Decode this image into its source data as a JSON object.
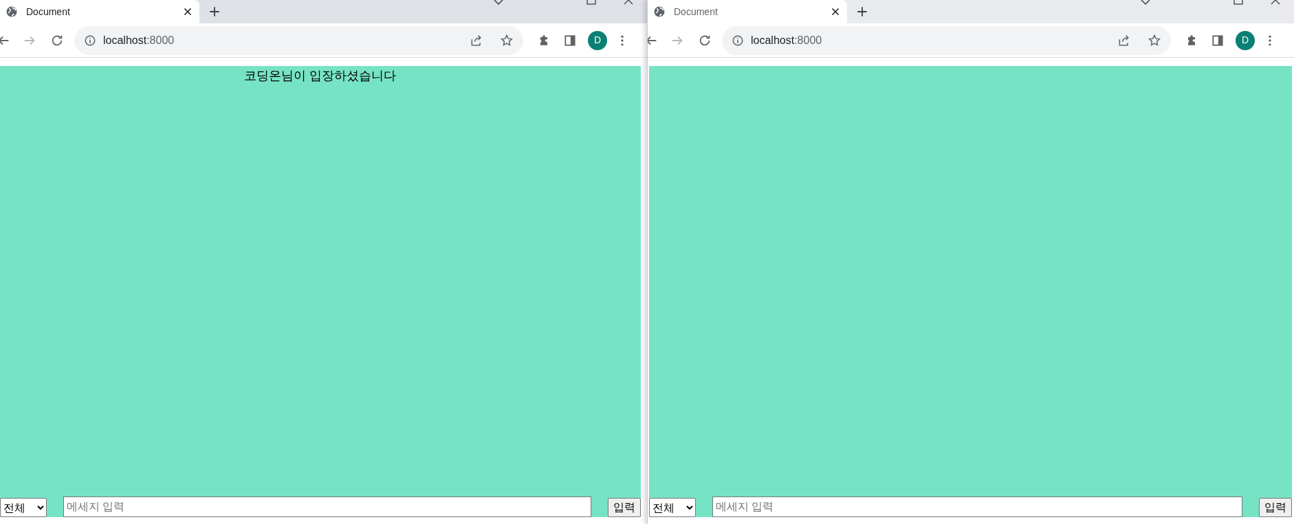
{
  "windows": [
    {
      "focused": true,
      "tab": {
        "title": "Document"
      },
      "address": {
        "host": "localhost",
        "port": ":8000"
      },
      "profile": {
        "letter": "D"
      },
      "messages": [
        "코딩온님이 입장하셨습니다"
      ],
      "chat_form": {
        "recipient": "전체",
        "placeholder": "메세지 입력",
        "submit": "입력"
      }
    },
    {
      "focused": false,
      "tab": {
        "title": "Document"
      },
      "address": {
        "host": "localhost",
        "port": ":8000"
      },
      "profile": {
        "letter": "D"
      },
      "chat_form": {
        "recipient": "전체",
        "placeholder": "메세지 입력",
        "submit": "입력"
      }
    }
  ]
}
